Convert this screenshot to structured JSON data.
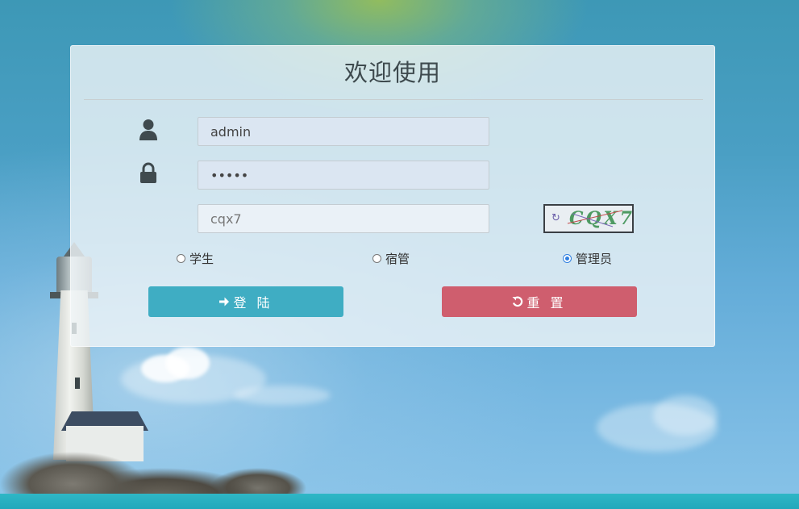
{
  "page": {
    "title": "欢迎使用"
  },
  "form": {
    "username_value": "admin",
    "password_value": "•••••",
    "captcha_value": "cqx7",
    "captcha_image_text": "CQX7",
    "roles": [
      {
        "label": "学生",
        "checked": false
      },
      {
        "label": "宿管",
        "checked": false
      },
      {
        "label": "管理员",
        "checked": true
      }
    ],
    "login_label": "登 陆",
    "reset_label": "重 置"
  },
  "icons": {
    "username": "user-icon",
    "password": "lock-icon",
    "captcha_refresh": "refresh-icon",
    "login": "arrow-right-icon",
    "reset": "undo-icon"
  },
  "colors": {
    "login_button": "#3fadc3",
    "reset_button": "#cf5e6e",
    "radio_checked": "#2f7fe0",
    "title_text": "#3e4a4e"
  }
}
